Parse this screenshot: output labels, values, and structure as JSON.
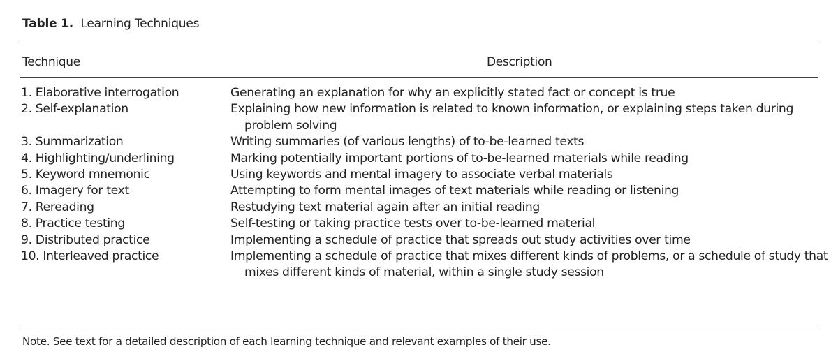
{
  "caption": {
    "label": "Table 1.",
    "title": "Learning Techniques"
  },
  "table": {
    "headers": [
      "Technique",
      "Description"
    ],
    "rows": [
      {
        "technique": "1. Elaborative interrogation",
        "description": "Generating an explanation for why an explicitly stated fact or concept is true"
      },
      {
        "technique": "2. Self-explanation",
        "description": "Explaining how new information is related to known information, or explaining steps taken during problem solving"
      },
      {
        "technique": "3. Summarization",
        "description": "Writing summaries (of various lengths) of to-be-learned texts"
      },
      {
        "technique": "4. Highlighting/underlining",
        "description": "Marking potentially important portions of to-be-learned materials while reading"
      },
      {
        "technique": "5. Keyword mnemonic",
        "description": "Using keywords and mental imagery to associate verbal materials"
      },
      {
        "technique": "6. Imagery for text",
        "description": "Attempting to form mental images of text materials while reading or listening"
      },
      {
        "technique": "7. Rereading",
        "description": "Restudying text material again after an initial reading"
      },
      {
        "technique": "8. Practice testing",
        "description": "Self-testing or taking practice tests over to-be-learned material"
      },
      {
        "technique": "9. Distributed practice",
        "description": "Implementing a schedule of practice that spreads out study activities over time"
      },
      {
        "technique": "10. Interleaved practice",
        "description": "Implementing a schedule of practice that mixes different kinds of problems, or a schedule of study that mixes different kinds of material, within a single study session"
      }
    ]
  },
  "note": "Note. See text for a detailed description of each learning technique and relevant examples of their use."
}
